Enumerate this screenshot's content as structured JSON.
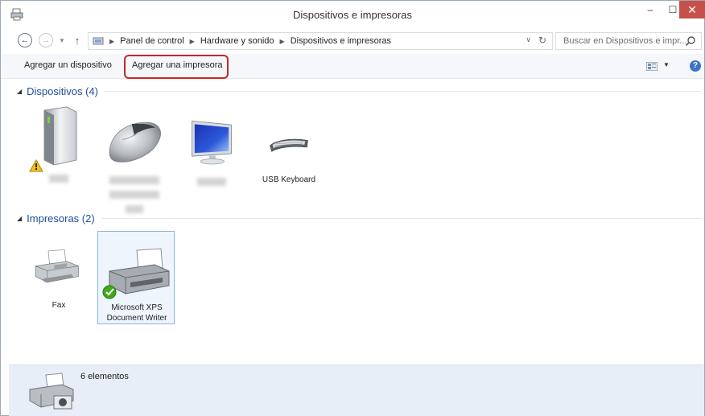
{
  "window": {
    "title": "Dispositivos e impresoras",
    "controls": {
      "minimize": "–",
      "maximize": "☐",
      "close": "✕"
    }
  },
  "address_bar": {
    "breadcrumbs": [
      "Panel de control",
      "Hardware y sonido",
      "Dispositivos e impresoras"
    ],
    "search_placeholder": "Buscar en Dispositivos e impr..."
  },
  "command_bar": {
    "add_device": "Agregar un dispositivo",
    "add_printer": "Agregar una impresora"
  },
  "groups": {
    "devices": {
      "title": "Dispositivos (4)",
      "items": [
        {
          "label": "",
          "icon": "computer-tower-icon",
          "warning": true
        },
        {
          "label": "",
          "icon": "mouse-icon"
        },
        {
          "label": "",
          "icon": "monitor-icon"
        },
        {
          "label": "USB Keyboard",
          "icon": "keyboard-icon"
        }
      ]
    },
    "printers": {
      "title": "Impresoras (2)",
      "items": [
        {
          "label": "Fax",
          "icon": "fax-icon"
        },
        {
          "label": "Microsoft XPS Document Writer",
          "label_line1": "Microsoft XPS",
          "label_line2": "Document Writer",
          "icon": "printer-icon",
          "default": true,
          "selected": true
        }
      ]
    }
  },
  "details_pane": {
    "count": "6 elementos"
  },
  "colors": {
    "group_title": "#1f4e9a",
    "highlight": "#c62828",
    "close_button": "#c7504a",
    "details_bg": "#e7eef7"
  }
}
